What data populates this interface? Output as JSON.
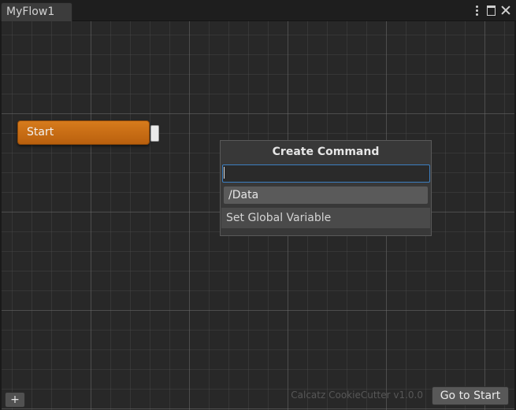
{
  "window": {
    "tab_title": "MyFlow1"
  },
  "icons": {
    "menu": "kebab-menu-icon",
    "maximize": "maximize-icon",
    "close": "close-icon"
  },
  "graph": {
    "start_node": {
      "label": "Start",
      "color": "#c96d16"
    }
  },
  "create_command": {
    "title": "Create Command",
    "search_value": "",
    "breadcrumb": "/Data",
    "items": [
      {
        "label": "Set Global Variable"
      }
    ]
  },
  "footer": {
    "add_label": "+",
    "watermark": "Calcatz CookieCutter v1.0.0",
    "goto_label": "Go to Start"
  }
}
